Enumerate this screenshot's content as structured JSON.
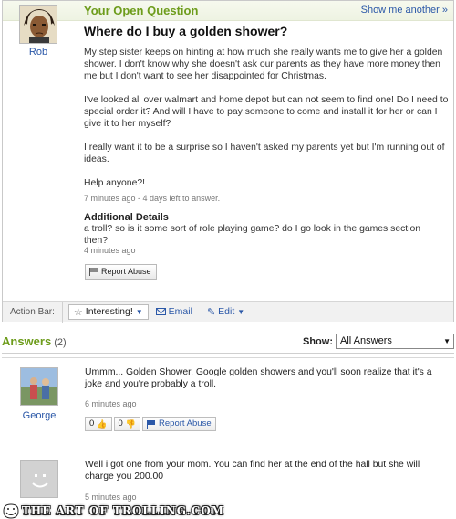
{
  "question": {
    "header_title": "Your Open Question",
    "header_link": "Show me another »",
    "asker_name": "Rob",
    "title": "Where do I buy a golden shower?",
    "body": [
      "My step sister keeps on hinting at how much she really wants me to give her a golden shower. I don't know why she doesn't ask our parents as they have more money then me but I don't want to see her disappointed for Christmas.",
      "I've looked all over walmart and home depot but can not seem to find one! Do I need to special order it? And will I have to pay someone to come and install it for her or can I give it to her myself?",
      "I really want it to be a surprise so I haven't asked my parents yet but I'm running out of ideas.",
      "Help anyone?!"
    ],
    "meta": "7 minutes ago - 4 days left to answer.",
    "additional_heading": "Additional Details",
    "additional_text": "a troll? so is it some sort of role playing game? do I go look in the games section then?",
    "additional_meta": "4 minutes ago",
    "report_label": "Report Abuse"
  },
  "action_bar": {
    "label": "Action Bar:",
    "interesting": "Interesting!",
    "email": "Email",
    "edit": "Edit"
  },
  "answers_header": {
    "title": "Answers",
    "count": "(2)",
    "show_label": "Show:",
    "show_selected": "All Answers"
  },
  "answers": [
    {
      "name": "George",
      "text": "Ummm... Golden Shower. Google golden showers and you'll soon realize that it's a joke and you're probably a troll.",
      "meta": "6 minutes ago",
      "thumbs_up": "0",
      "thumbs_down": "0",
      "report_label": "Report Abuse"
    },
    {
      "name": "",
      "text": "Well i got one from your mom. You can find her at the end of the hall but she will charge you 200.00",
      "meta": "5 minutes ago"
    }
  ],
  "watermark": "THE ART OF TROLLING.COM",
  "colors": {
    "brand_green": "#6d9c1b",
    "link_blue": "#2b58a8"
  }
}
